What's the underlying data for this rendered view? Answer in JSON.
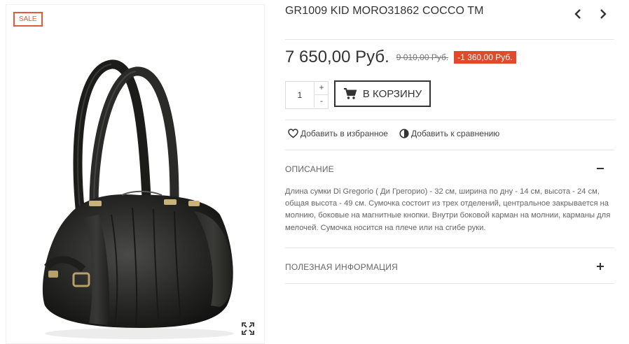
{
  "product": {
    "title": "GR1009 KID MORO31862 COCCO TM",
    "sale_badge": "SALE",
    "price": "7 650,00 Руб.",
    "old_price": "9 010,00 Руб.",
    "discount": "-1 360,00 Руб."
  },
  "cart": {
    "quantity": "1",
    "plus": "+",
    "minus": "-",
    "add_to_cart_label": "В КОРЗИНУ"
  },
  "actions": {
    "wishlist_label": "Добавить в избранное",
    "compare_label": "Добавить к сравнению"
  },
  "accordion": {
    "description_title": "ОПИСАНИЕ",
    "description_text": "Длина сумки Di Gregorio ( Ди Грегорио) - 32 см, ширина по дну - 14 см, высота - 24 см, общая высота - 49 см. Сумочка состоит из трех отделений, центральное закрывается на молнию, боковые на магнитные кнопки. Внутри боковой карман на молнии, карманы для мелочей. Сумочка носится на плече или на сгибе руки.",
    "useful_info_title": "ПОЛЕЗНАЯ ИНФОРМАЦИЯ"
  },
  "icons": {
    "prev": "chevron-left-icon",
    "next": "chevron-right-icon",
    "cart": "cart-icon",
    "heart": "heart-icon",
    "compare": "compare-icon",
    "collapse": "minus-icon",
    "expand": "plus-icon",
    "zoom": "expand-icon"
  },
  "colors": {
    "sale": "#e05b3a",
    "discount_bg": "#e0492c",
    "text": "#333333"
  }
}
